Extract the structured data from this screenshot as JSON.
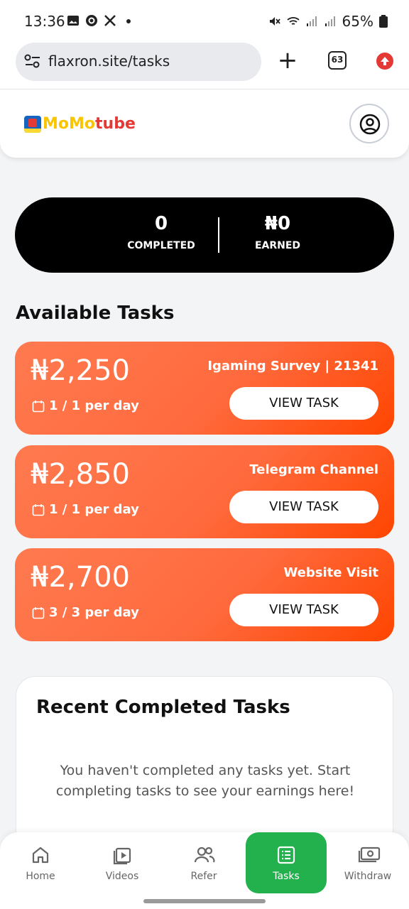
{
  "status_bar": {
    "time": "13:36",
    "battery": "65%",
    "icons": [
      "image-icon",
      "threads-icon",
      "x-icon",
      "dot-icon",
      "mute-icon",
      "wifi-icon",
      "signal-icon",
      "signal-icon",
      "battery-icon"
    ]
  },
  "browser": {
    "url": "flaxron.site/tasks",
    "tab_count": "63"
  },
  "header": {
    "logo_part1": "MoMo",
    "logo_part2": "tube"
  },
  "stats": {
    "completed_value": "0",
    "completed_label": "COMPLETED",
    "earned_value": "₦0",
    "earned_label": "EARNED"
  },
  "section_title": "Available Tasks",
  "tasks": [
    {
      "amount": "₦2,250",
      "title": "Igaming Survey | 21341",
      "limit": "1 / 1 per day",
      "button": "VIEW TASK"
    },
    {
      "amount": "₦2,850",
      "title": "Telegram Channel",
      "limit": "1 / 1 per day",
      "button": "VIEW TASK"
    },
    {
      "amount": "₦2,700",
      "title": "Website Visit",
      "limit": "3 / 3 per day",
      "button": "VIEW TASK"
    }
  ],
  "recent": {
    "title": "Recent Completed Tasks",
    "empty_message": "You haven't completed any tasks yet. Start completing tasks to see your earnings here!"
  },
  "bottom_nav": [
    {
      "label": "Home",
      "icon": "home-icon",
      "active": false
    },
    {
      "label": "Videos",
      "icon": "video-icon",
      "active": false
    },
    {
      "label": "Refer",
      "icon": "users-icon",
      "active": false
    },
    {
      "label": "Tasks",
      "icon": "list-icon",
      "active": true
    },
    {
      "label": "Withdraw",
      "icon": "cash-icon",
      "active": false
    }
  ],
  "colors": {
    "accent_green": "#22b14c",
    "task_gradient_start": "#ff7a50",
    "task_gradient_end": "#ff4500",
    "stats_bg": "#000000"
  }
}
